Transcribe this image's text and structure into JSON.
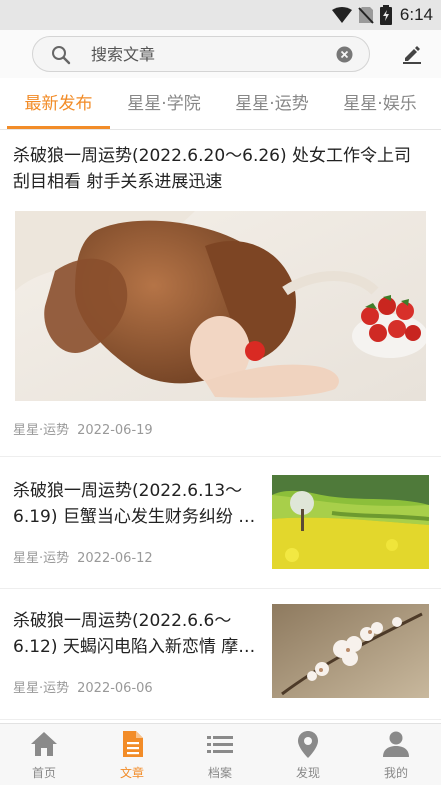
{
  "status_bar": {
    "time": "6:14",
    "icons": [
      "wifi-icon",
      "no-sim-icon",
      "battery-charging-icon"
    ]
  },
  "search": {
    "placeholder": "搜索文章",
    "value": "",
    "left_icon": "search-icon",
    "clear_icon": "clear-icon",
    "right_icon": "edit-icon"
  },
  "tabs": [
    {
      "label": "最新发布",
      "active": true
    },
    {
      "label": "星星·学院",
      "active": false
    },
    {
      "label": "星星·运势",
      "active": false
    },
    {
      "label": "星星·娱乐",
      "active": false
    }
  ],
  "articles": [
    {
      "title_line1": "杀破狼一周运势(2022.6.20～6.26) 处女工作令上司",
      "title_line2": "刮目相看 射手关系进展迅速",
      "category": "星星·运势",
      "date": "2022-06-19",
      "image": "woman-with-strawberries-photo"
    },
    {
      "title_line1": "杀破狼一周运势(2022.6.13～",
      "title_line2": "6.19) 巨蟹当心发生财务纠纷 …",
      "category": "星星·运势",
      "date": "2022-06-12",
      "image": "rapeseed-field-photo"
    },
    {
      "title_line1": "杀破狼一周运势(2022.6.6～",
      "title_line2": "6.12) 天蝎闪电陷入新恋情 摩…",
      "category": "星星·运势",
      "date": "2022-06-06",
      "image": "white-blossom-photo"
    }
  ],
  "bottom_nav": [
    {
      "label": "首页",
      "icon": "home-icon",
      "active": false
    },
    {
      "label": "文章",
      "icon": "document-icon",
      "active": true
    },
    {
      "label": "档案",
      "icon": "list-icon",
      "active": false
    },
    {
      "label": "发现",
      "icon": "location-pin-icon",
      "active": false
    },
    {
      "label": "我的",
      "icon": "person-icon",
      "active": false
    }
  ],
  "colors": {
    "accent": "#f28c28",
    "inactive": "#888888",
    "status_bar_bg": "#e6e6e6"
  }
}
